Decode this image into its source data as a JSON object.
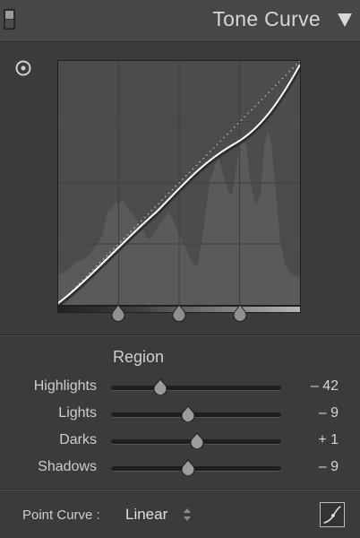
{
  "panel": {
    "title": "Tone Curve",
    "icons": {
      "solo": "panel-switch-icon",
      "collapse": "triangle-down-icon",
      "target": "targeted-adjustment-icon",
      "edit": "edit-point-curve-icon"
    }
  },
  "region": {
    "title": "Region",
    "sliders": [
      {
        "label": "Highlights",
        "value": "– 42",
        "level": 0.29
      },
      {
        "label": "Lights",
        "value": "– 9",
        "level": 0.455
      },
      {
        "label": "Darks",
        "value": "+ 1",
        "level": 0.505
      },
      {
        "label": "Shadows",
        "value": "– 9",
        "level": 0.455
      }
    ]
  },
  "point_curve": {
    "label": "Point Curve :",
    "value": "Linear"
  },
  "splits": [
    0.25,
    0.5,
    0.75
  ],
  "colors": {
    "panel_bg": "#3b3b3b",
    "graph_bg": "#4c4c4c",
    "curve": "#ffffff"
  }
}
